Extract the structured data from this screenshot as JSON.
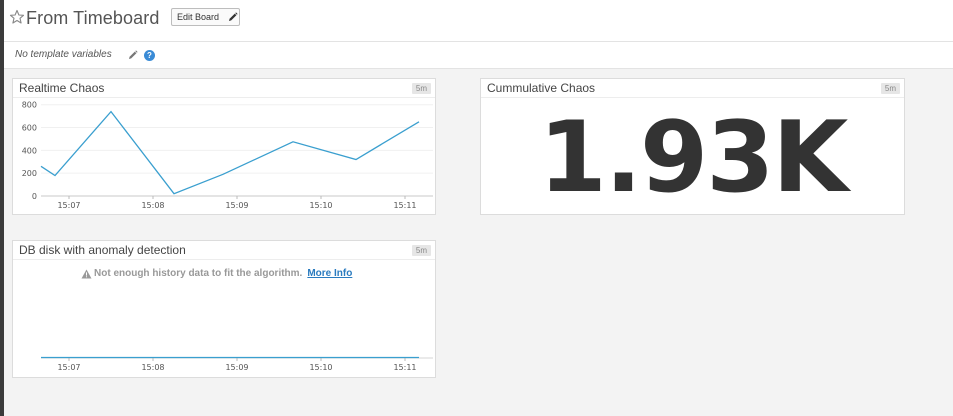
{
  "header": {
    "title": "From Timeboard",
    "edit_button": "Edit Board"
  },
  "template_bar": {
    "text": "No template variables"
  },
  "widgets": {
    "realtime": {
      "title": "Realtime Chaos",
      "badge": "5m",
      "y_ticks": [
        "800",
        "600",
        "400",
        "200",
        "0"
      ],
      "x_ticks": [
        "15:07",
        "15:08",
        "15:09",
        "15:10",
        "15:11"
      ]
    },
    "cumulative": {
      "title": "Cummulative Chaos",
      "badge": "5m",
      "value": "1.93K"
    },
    "db_disk": {
      "title": "DB disk with anomaly detection",
      "badge": "5m",
      "warning": "Not enough history data to fit the algorithm.",
      "more_info": "More Info",
      "x_ticks": [
        "15:07",
        "15:08",
        "15:09",
        "15:10",
        "15:11"
      ]
    }
  },
  "chart_data": [
    {
      "type": "line",
      "title": "Realtime Chaos",
      "x": [
        "15:06:40",
        "15:06:50",
        "15:07:30",
        "15:08:15",
        "15:08:50",
        "15:09:40",
        "15:10:25",
        "15:11:10"
      ],
      "series": [
        {
          "values": [
            260,
            180,
            740,
            20,
            190,
            475,
            320,
            650
          ]
        }
      ],
      "x_ticks": [
        "15:07",
        "15:08",
        "15:09",
        "15:10",
        "15:11"
      ],
      "y_ticks": [
        0,
        200,
        400,
        600,
        800
      ],
      "ylim": [
        0,
        850
      ],
      "grid": true,
      "color": "#3a9fcf"
    },
    {
      "type": "line",
      "title": "DB disk with anomaly detection",
      "x": [
        "15:06:40",
        "15:11:10"
      ],
      "series": [
        {
          "values": [
            0,
            0
          ]
        }
      ],
      "x_ticks": [
        "15:07",
        "15:08",
        "15:09",
        "15:10",
        "15:11"
      ],
      "color": "#3a9fcf"
    }
  ]
}
